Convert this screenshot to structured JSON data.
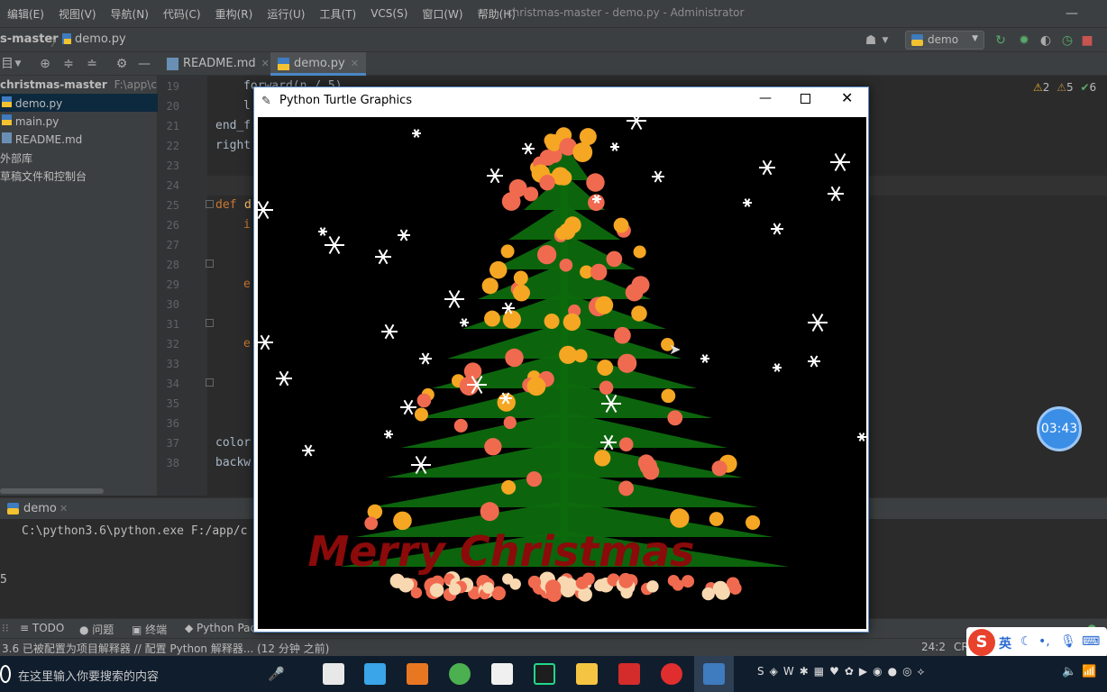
{
  "menubar": {
    "items": [
      "编辑(E)",
      "视图(V)",
      "导航(N)",
      "代码(C)",
      "重构(R)",
      "运行(U)",
      "工具(T)",
      "VCS(S)",
      "窗口(W)",
      "帮助(H)"
    ],
    "window_title": "christmas-master - demo.py - Administrator"
  },
  "navbar": {
    "project": "s-master",
    "file": "demo.py",
    "run_config": "demo"
  },
  "tabs": [
    {
      "label": "README.md",
      "active": false
    },
    {
      "label": "demo.py",
      "active": true
    }
  ],
  "project_tree": {
    "root": "christmas-master",
    "root_path": "F:\\app\\chri",
    "items": [
      "demo.py",
      "main.py",
      "README.md",
      "外部库",
      "草稿文件和控制台"
    ]
  },
  "editor": {
    "line_numbers": [
      "19",
      "20",
      "21",
      "22",
      "23",
      "24",
      "25",
      "26",
      "27",
      "28",
      "29",
      "30",
      "31",
      "32",
      "33",
      "34",
      "35",
      "36",
      "37",
      "38"
    ],
    "lines": {
      "l19": "forward(n / 5)",
      "l20": "l",
      "l21": "end_f",
      "l22": "right",
      "l25_kw": "def",
      "l25_fn": "d",
      "l26": "i",
      "l29": "e",
      "l32": "e",
      "l37": "color",
      "l38": "backw"
    },
    "warnings": {
      "w1": "2",
      "w2": "5",
      "ok": "6"
    }
  },
  "run": {
    "tab_label": "demo",
    "output_line": "C:\\python3.6\\python.exe F:/app/c",
    "side_mark": "5"
  },
  "bottom_tools": [
    "TODO",
    "问题",
    "终端",
    "Python Pac"
  ],
  "status": {
    "message": "3.6 已被配置为项目解释器 // 配置 Python 解释器... (12 分钟 之前)",
    "position": "24:2",
    "line_sep": "CR"
  },
  "turtle": {
    "title": "Python Turtle Graphics",
    "text": "Merry Christmas",
    "colors": {
      "tree": "#0d6a0d",
      "ornament_red": "#f06a50",
      "ornament_orange": "#f5a623",
      "text": "#8b0a0a",
      "ground": "#f8d8b0"
    }
  },
  "taskbar": {
    "search_placeholder": "在这里输入你要搜索的内容",
    "ime_label": "英"
  },
  "timer": "03:43"
}
